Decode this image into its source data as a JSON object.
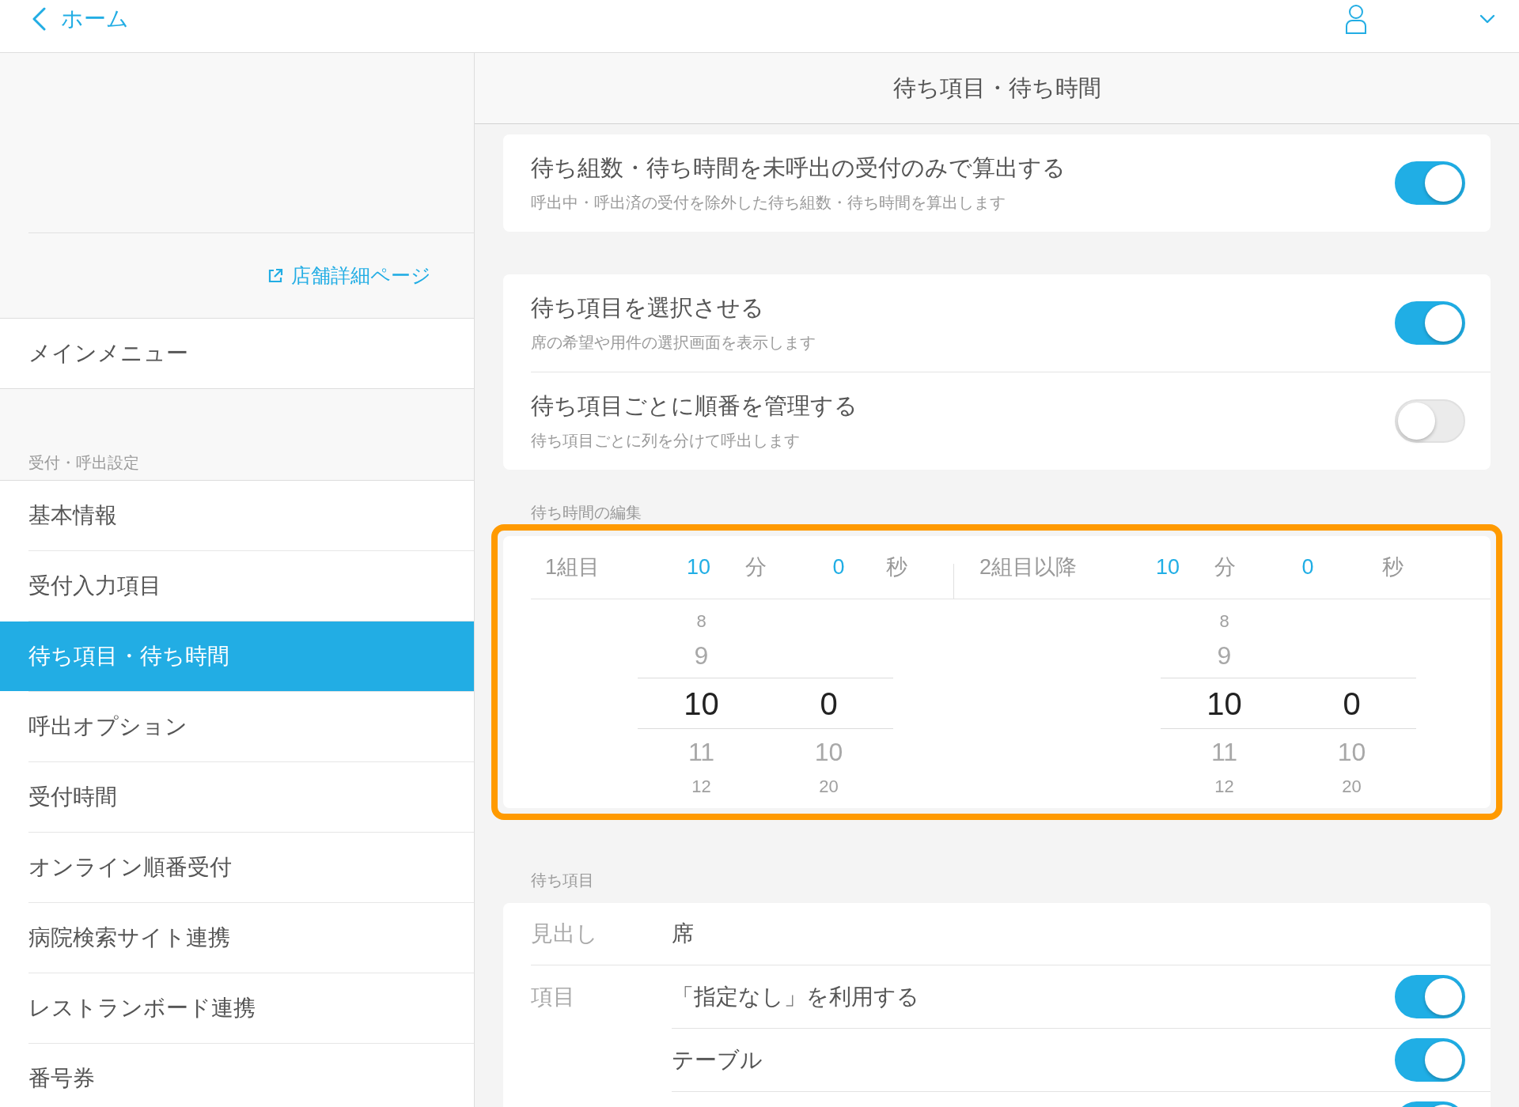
{
  "header": {
    "back_label": "ホーム"
  },
  "sidebar": {
    "store_link": "店舗詳細ページ",
    "main_menu": "メインメニュー",
    "section_label": "受付・呼出設定",
    "items": [
      {
        "label": "基本情報",
        "selected": false
      },
      {
        "label": "受付入力項目",
        "selected": false
      },
      {
        "label": "待ち項目・待ち時間",
        "selected": true
      },
      {
        "label": "呼出オプション",
        "selected": false
      },
      {
        "label": "受付時間",
        "selected": false
      },
      {
        "label": "オンライン順番受付",
        "selected": false
      },
      {
        "label": "病院検索サイト連携",
        "selected": false
      },
      {
        "label": "レストランボード連携",
        "selected": false
      },
      {
        "label": "番号券",
        "selected": false
      }
    ]
  },
  "main": {
    "title": "待ち項目・待ち時間",
    "setting_cards": [
      {
        "rows": [
          {
            "title": "待ち組数・待ち時間を未呼出の受付のみで算出する",
            "description": "呼出中・呼出済の受付を除外した待ち組数・待ち時間を算出します",
            "on": true
          }
        ]
      },
      {
        "rows": [
          {
            "title": "待ち項目を選択させる",
            "description": "席の希望や用件の選択画面を表示します",
            "on": true
          },
          {
            "title": "待ち項目ごとに順番を管理する",
            "description": "待ち項目ごとに列を分けて呼出します",
            "on": false
          }
        ]
      }
    ],
    "wait_time": {
      "label": "待ち時間の編集",
      "highlighted": true,
      "groups": [
        {
          "label": "1組目",
          "minutes": "10",
          "minutes_unit": "分",
          "seconds": "0",
          "seconds_unit": "秒",
          "wheels": [
            {
              "options": [
                {
                  "text": "8",
                  "selected": false
                },
                {
                  "text": "9",
                  "selected": false
                },
                {
                  "text": "10",
                  "selected": true
                },
                {
                  "text": "11",
                  "selected": false
                },
                {
                  "text": "12",
                  "selected": false
                }
              ]
            },
            {
              "options": [
                {
                  "text": "0",
                  "selected": true
                },
                {
                  "text": "10",
                  "selected": false
                },
                {
                  "text": "20",
                  "selected": false
                }
              ]
            }
          ]
        },
        {
          "label": "2組目以降",
          "minutes": "10",
          "minutes_unit": "分",
          "seconds": "0",
          "seconds_unit": "秒",
          "wheels": [
            {
              "options": [
                {
                  "text": "8",
                  "selected": false
                },
                {
                  "text": "9",
                  "selected": false
                },
                {
                  "text": "10",
                  "selected": true
                },
                {
                  "text": "11",
                  "selected": false
                },
                {
                  "text": "12",
                  "selected": false
                }
              ]
            },
            {
              "options": [
                {
                  "text": "0",
                  "selected": true
                },
                {
                  "text": "10",
                  "selected": false
                },
                {
                  "text": "20",
                  "selected": false
                }
              ]
            }
          ]
        }
      ]
    },
    "wait_items": {
      "label": "待ち項目",
      "heading_label": "見出し",
      "heading_value": "席",
      "items_label": "項目",
      "items": [
        {
          "label": "「指定なし」を利用する",
          "on": true
        },
        {
          "label": "テーブル",
          "on": true
        },
        {
          "on": true
        }
      ]
    }
  }
}
